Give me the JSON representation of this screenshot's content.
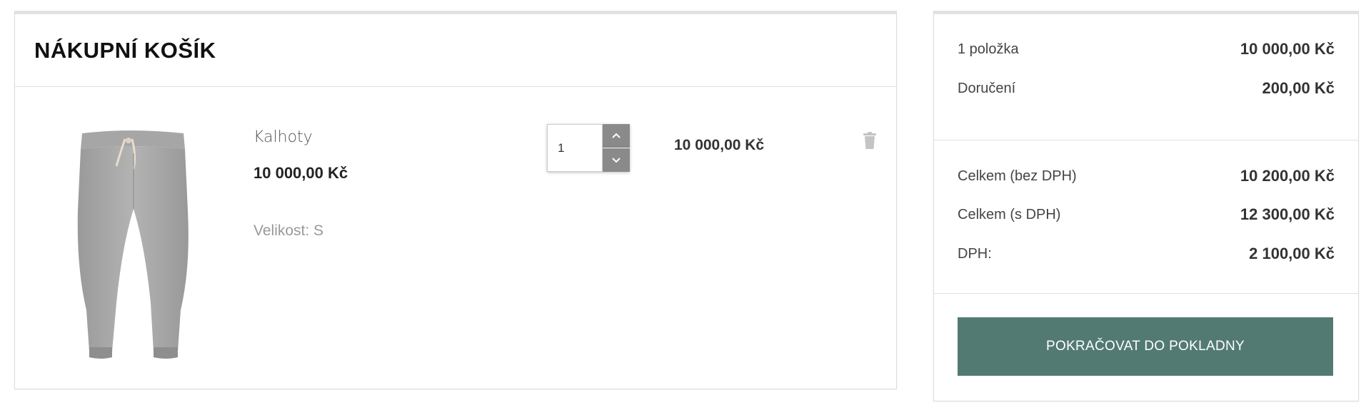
{
  "cart": {
    "title": "NÁKUPNÍ KOŠÍK",
    "items": [
      {
        "image_icon": "pants-product-image",
        "name": "Kalhoty",
        "price": "10 000,00 Kč",
        "size": "Velikost: S",
        "quantity": "1",
        "line_total": "10 000,00 Kč",
        "delete_icon": "trash-icon"
      }
    ]
  },
  "summary": {
    "items_label": "1 položka",
    "items_value": "10 000,00 Kč",
    "shipping_label": "Doručení",
    "shipping_value": "200,00 Kč",
    "total_net_label": "Celkem (bez DPH)",
    "total_net_value": "10 200,00 Kč",
    "total_gross_label": "Celkem (s DPH)",
    "total_gross_value": "12 300,00 Kč",
    "vat_label": "DPH:",
    "vat_value": "2 100,00 Kč",
    "checkout_label": "POKRAČOVAT DO POKLADNY"
  },
  "colors": {
    "checkout_button": "#527a73",
    "stepper_button": "#8a8a8a"
  }
}
